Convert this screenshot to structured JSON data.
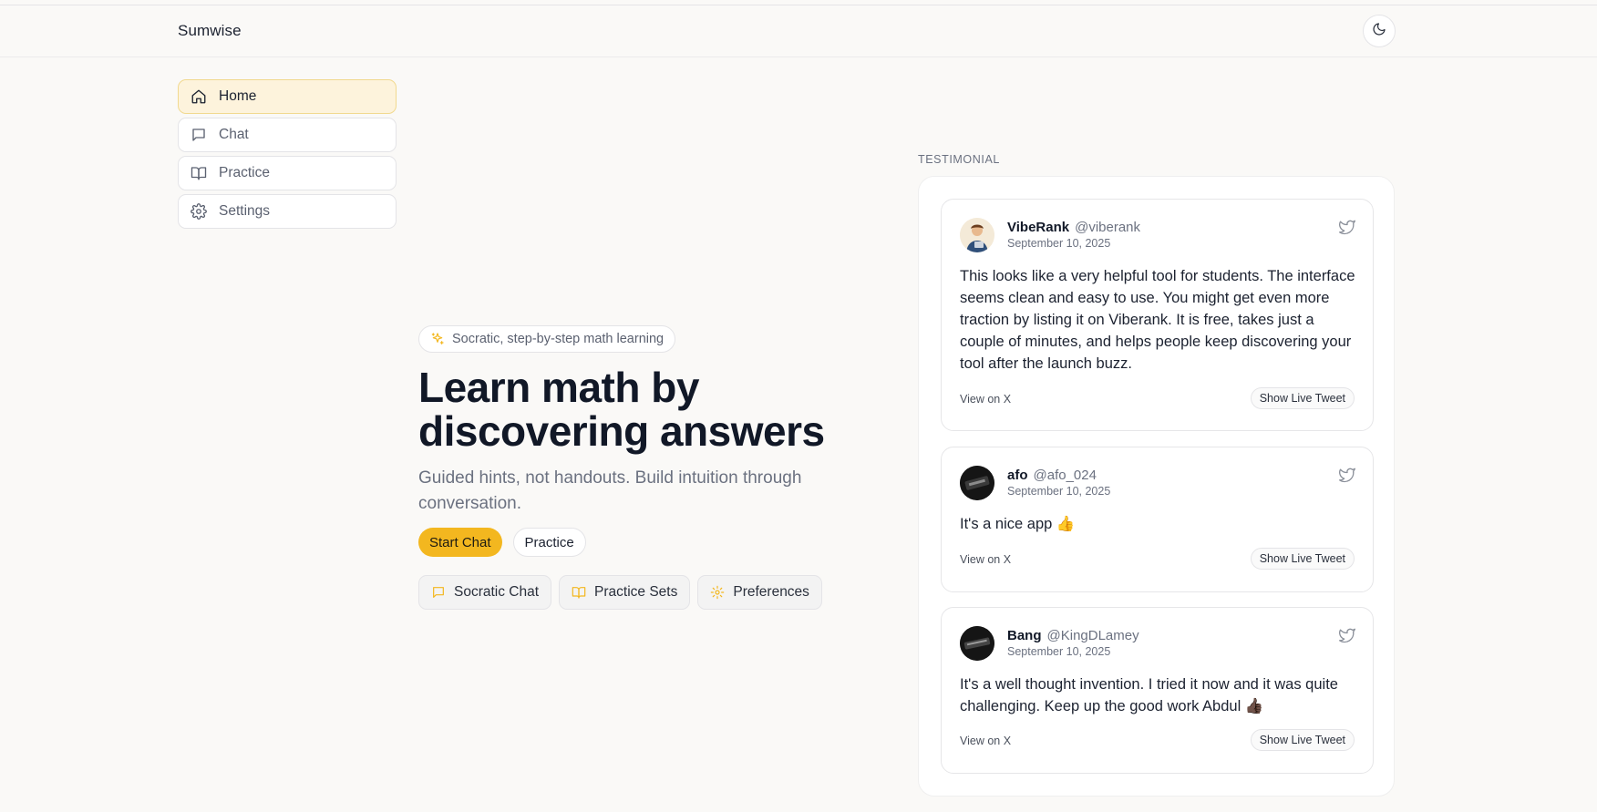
{
  "app": {
    "brand": "Sumwise"
  },
  "colors": {
    "accent": "#f3b71f",
    "active_nav_bg": "#fdf3dc",
    "text": "#1c2230",
    "muted": "#6b7180"
  },
  "header": {
    "theme_toggle_icon": "moon-icon"
  },
  "sidebar": {
    "items": [
      {
        "label": "Home",
        "icon": "home-icon",
        "active": true
      },
      {
        "label": "Chat",
        "icon": "chat-bubble-icon",
        "active": false
      },
      {
        "label": "Practice",
        "icon": "book-open-icon",
        "active": false
      },
      {
        "label": "Settings",
        "icon": "gear-icon",
        "active": false
      }
    ]
  },
  "hero": {
    "pill": "Socratic, step-by-step math learning",
    "headline_line1": "Learn math by",
    "headline_line2": "discovering answers",
    "subtitle": "Guided hints, not handouts. Build intuition through conversation.",
    "primary_cta": "Start Chat",
    "secondary_cta": "Practice",
    "features": [
      {
        "label": "Socratic Chat",
        "icon": "chat-bubble-icon"
      },
      {
        "label": "Practice Sets",
        "icon": "book-open-icon"
      },
      {
        "label": "Preferences",
        "icon": "gear-icon"
      }
    ]
  },
  "testimonials": {
    "section_label": "TESTIMONIAL",
    "view_label": "View on X",
    "live_label": "Show Live Tweet",
    "items": [
      {
        "name": "VibeRank",
        "handle": "@viberank",
        "date": "September 10, 2025",
        "text": "This looks like a very helpful tool for students. The interface seems clean and easy to use. You might get even more traction by listing it on Viberank. It is free, takes just a couple of minutes, and helps people keep discovering your tool after the launch buzz."
      },
      {
        "name": "afo",
        "handle": "@afo_024",
        "date": "September 10, 2025",
        "text": "It's a nice app 👍"
      },
      {
        "name": "Bang",
        "handle": "@KingDLamey",
        "date": "September 10, 2025",
        "text": "It's a well thought invention. I tried it now and it was quite challenging. Keep up the good work Abdul 👍🏿"
      }
    ]
  }
}
